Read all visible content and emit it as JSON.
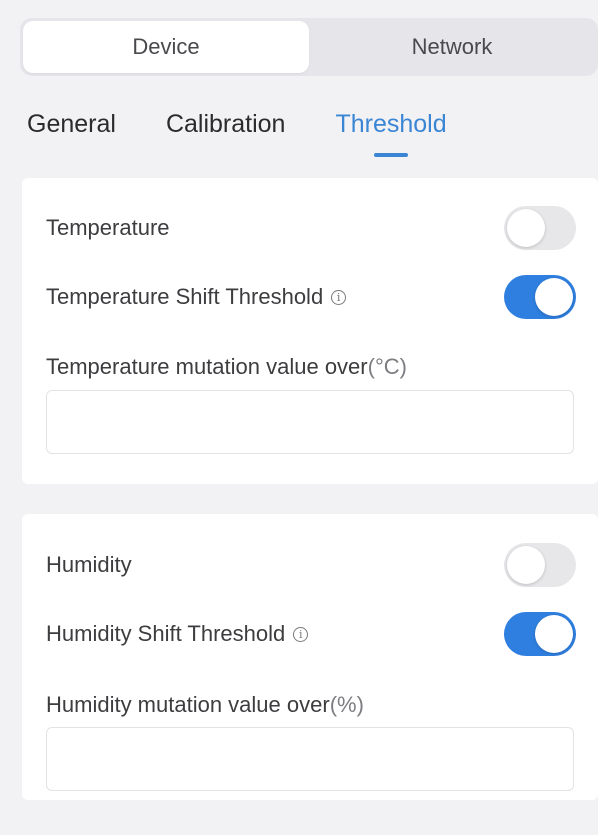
{
  "segmented": {
    "items": [
      {
        "label": "Device",
        "active": true
      },
      {
        "label": "Network",
        "active": false
      }
    ]
  },
  "subtabs": {
    "items": [
      {
        "label": "General",
        "active": false
      },
      {
        "label": "Calibration",
        "active": false
      },
      {
        "label": "Threshold",
        "active": true
      }
    ]
  },
  "temperature": {
    "label": "Temperature",
    "enabled": false,
    "shift_label": "Temperature Shift Threshold",
    "shift_enabled": true,
    "mutation_label": "Temperature mutation value over",
    "mutation_unit": "(°C)",
    "mutation_value": ""
  },
  "humidity": {
    "label": "Humidity",
    "enabled": false,
    "shift_label": "Humidity Shift Threshold",
    "shift_enabled": true,
    "mutation_label": "Humidity mutation value over",
    "mutation_unit": "(%)",
    "mutation_value": ""
  },
  "icons": {
    "info": "info-icon"
  },
  "colors": {
    "accent": "#2f7fe0",
    "tab_active": "#3a86d4",
    "toggle_off": "#e7e7ea",
    "background": "#f2f2f4"
  }
}
